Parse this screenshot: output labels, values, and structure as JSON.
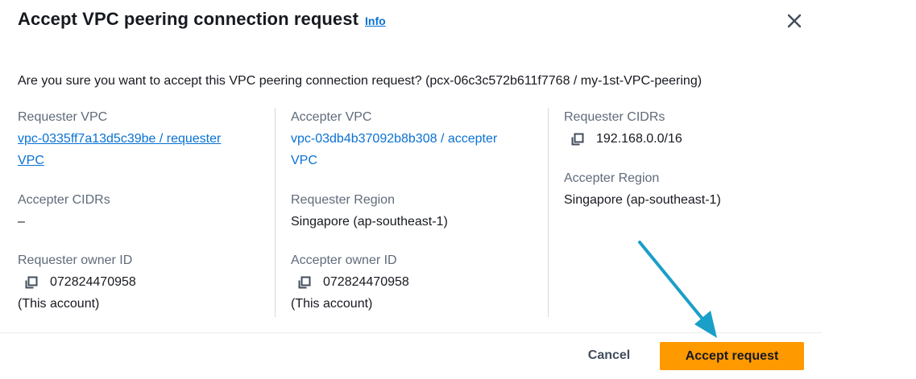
{
  "modal": {
    "title": "Accept VPC peering connection request",
    "info_label": "Info",
    "question": "Are you sure you want to accept this VPC peering connection request? (pcx-06c3c572b611f7768 / my-1st-VPC-peering)"
  },
  "details": {
    "requester_vpc": {
      "label": "Requester VPC",
      "line1": "vpc-0335ff7a13d5c39be / requester",
      "line2": "VPC"
    },
    "accepter_vpc": {
      "label": "Accepter VPC",
      "line1": "vpc-03db4b37092b8b308 / accepter",
      "line2": "VPC"
    },
    "requester_cidrs": {
      "label": "Requester CIDRs",
      "value": "192.168.0.0/16"
    },
    "accepter_cidrs": {
      "label": "Accepter CIDRs",
      "value": "–"
    },
    "requester_region": {
      "label": "Requester Region",
      "value": "Singapore (ap-southeast-1)"
    },
    "accepter_region": {
      "label": "Accepter Region",
      "value": "Singapore (ap-southeast-1)"
    },
    "requester_owner": {
      "label": "Requester owner ID",
      "value": "072824470958",
      "note": "(This account)"
    },
    "accepter_owner": {
      "label": "Accepter owner ID",
      "value": "072824470958",
      "note": "(This account)"
    }
  },
  "footer": {
    "cancel_label": "Cancel",
    "accept_label": "Accept request"
  },
  "icons": {
    "close": "close-icon",
    "copy": "copy-icon",
    "arrow": "annotation-arrow"
  },
  "colors": {
    "link": "#0972d3",
    "primary_button": "#ff9900",
    "label_text": "#5f6b7a",
    "annotation_arrow": "#1a9fc9"
  }
}
